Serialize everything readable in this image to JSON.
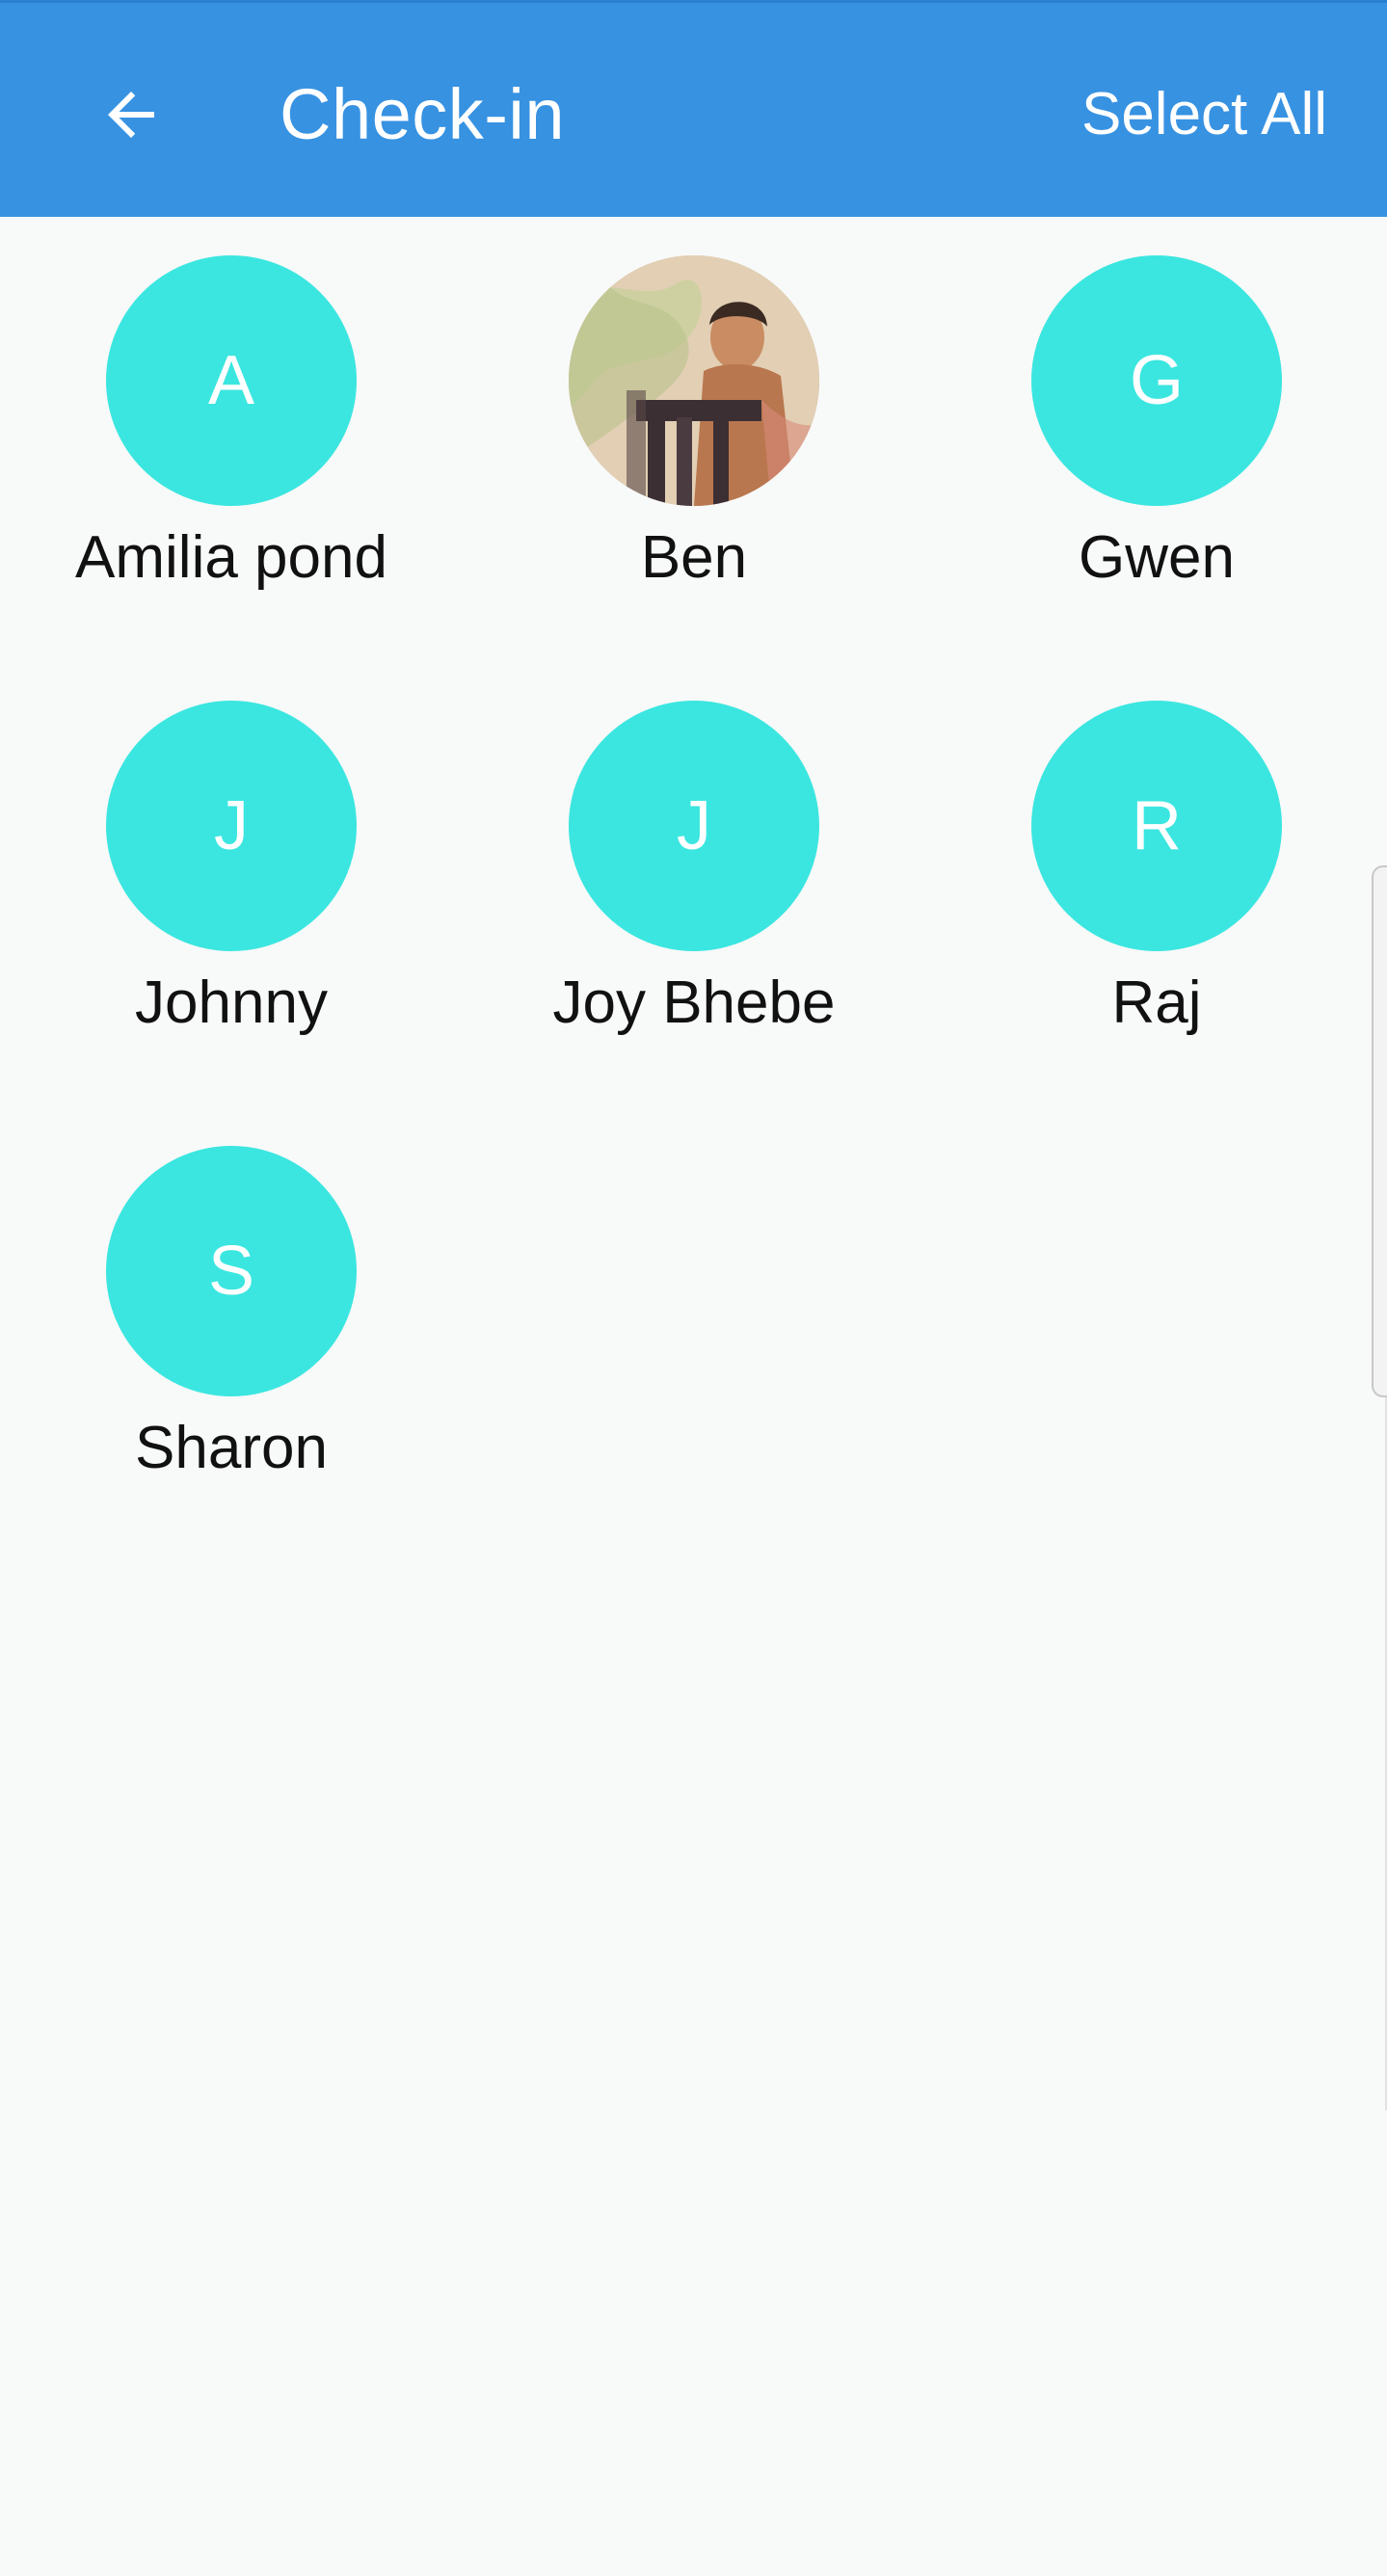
{
  "toolbar": {
    "title": "Check-in",
    "select_all_label": "Select All",
    "back_icon": "arrow-left-icon",
    "color": "#3792e2"
  },
  "people": [
    {
      "name": "Amilia pond",
      "initial": "A",
      "has_photo": false
    },
    {
      "name": "Ben",
      "initial": "",
      "has_photo": true
    },
    {
      "name": "Gwen",
      "initial": "G",
      "has_photo": false
    },
    {
      "name": "Johnny",
      "initial": "J",
      "has_photo": false
    },
    {
      "name": "Joy Bhebe",
      "initial": "J",
      "has_photo": false
    },
    {
      "name": "Raj",
      "initial": "R",
      "has_photo": false
    },
    {
      "name": "Sharon",
      "initial": "S",
      "has_photo": false
    }
  ],
  "avatar_color": "#3be6e0"
}
